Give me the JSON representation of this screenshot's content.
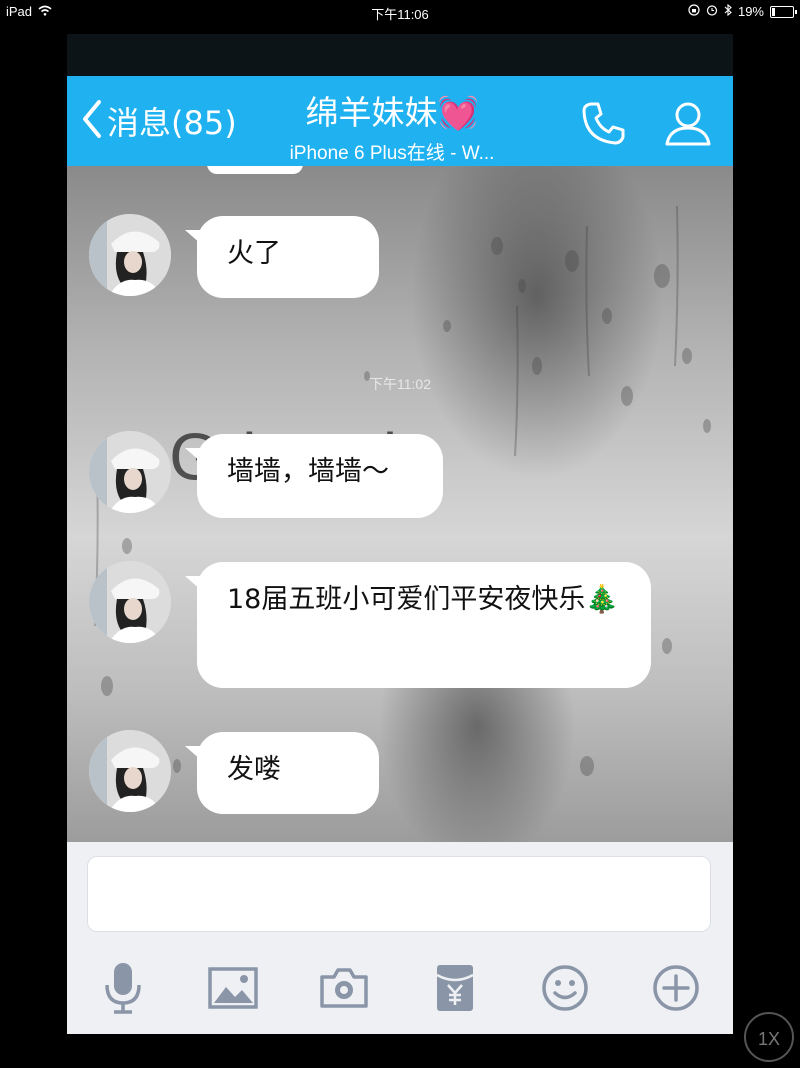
{
  "status_bar": {
    "device": "iPad",
    "time": "下午11:06",
    "battery": "19%",
    "battery_level": 0.19
  },
  "nav": {
    "back_label": "消息(85)",
    "contact_name": "绵羊妹妹",
    "name_emoji": "💓",
    "subtitle": "iPhone 6 Plus在线 - W..."
  },
  "chat": {
    "background_text": "G          lonely",
    "timestamp": "下午11:02",
    "messages": [
      {
        "text": "火了"
      },
      {
        "text": "墙墙，墙墙～"
      },
      {
        "text": "18届五班小可爱们平安夜快乐🎄"
      },
      {
        "text": "发喽"
      }
    ]
  },
  "input": {
    "placeholder": ""
  },
  "toolbar": [
    "microphone-icon",
    "image-icon",
    "camera-icon",
    "red-packet-icon",
    "emoji-icon",
    "plus-icon"
  ],
  "zoom_button": "1X",
  "colors": {
    "accent": "#1fb1f0",
    "bubble": "#ffffff",
    "toolbar_icon": "#8a96a8"
  }
}
